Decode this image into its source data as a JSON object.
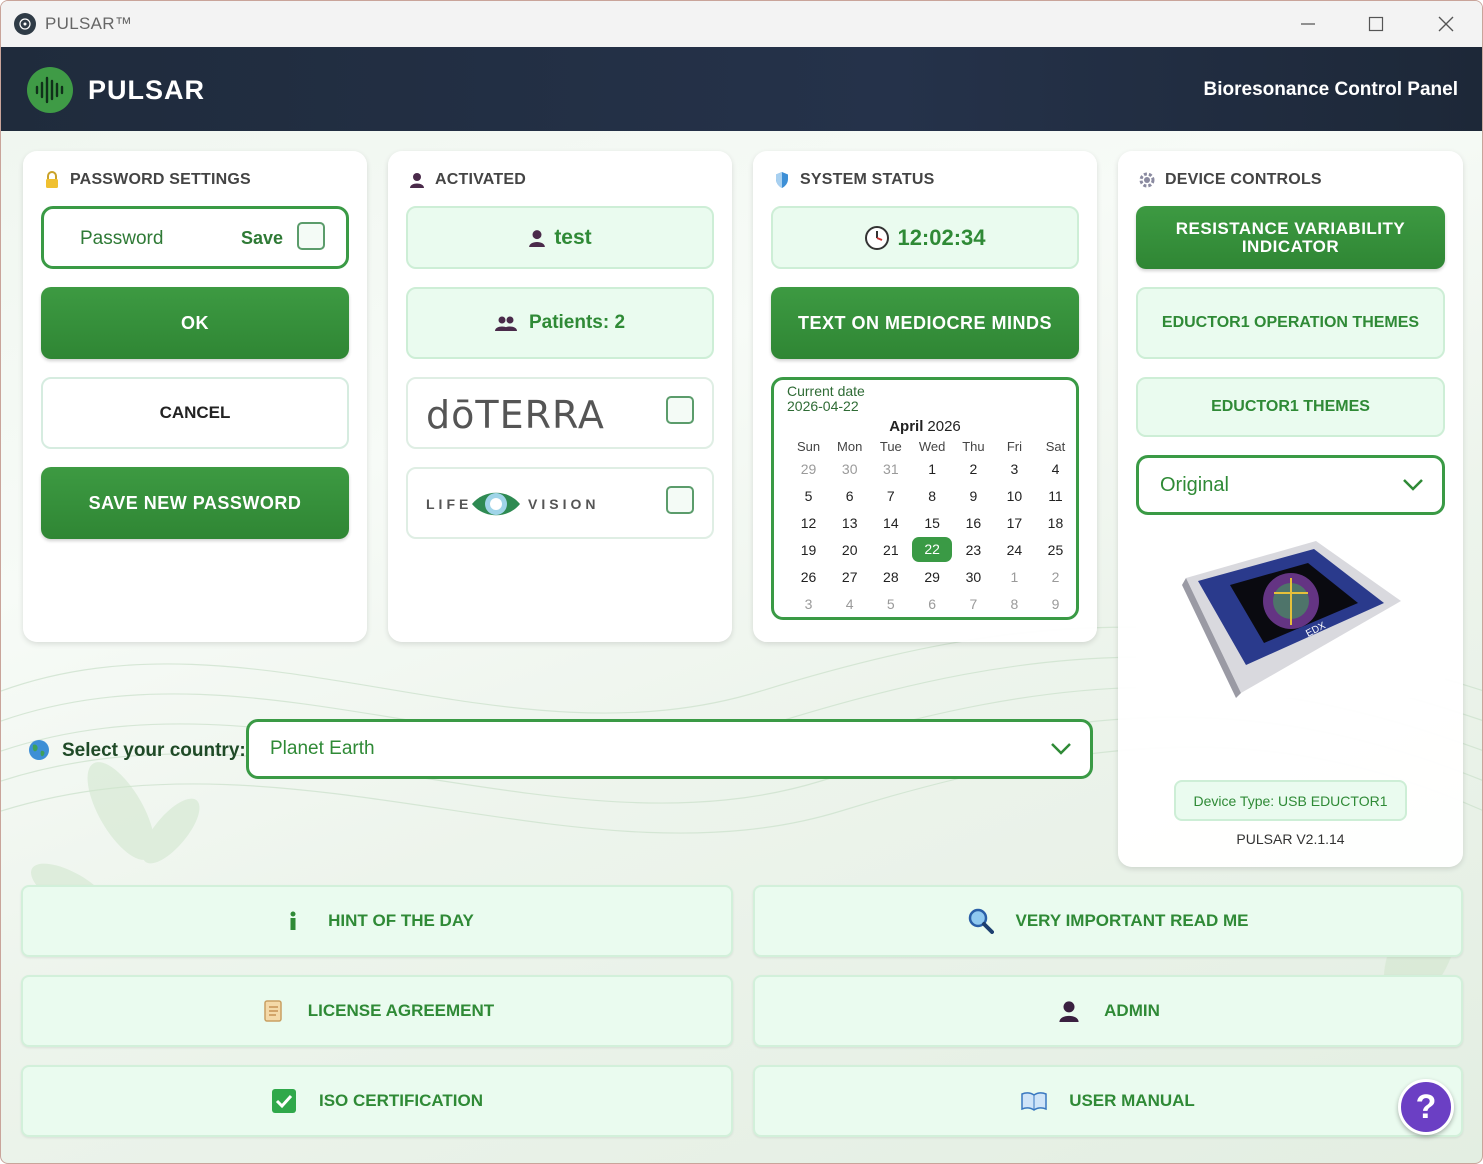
{
  "window": {
    "title": "PULSAR™"
  },
  "header": {
    "brand": "PULSAR",
    "subtitle": "Bioresonance Control Panel"
  },
  "password_panel": {
    "title": "PASSWORD SETTINGS",
    "password_placeholder": "Password",
    "save_label": "Save",
    "ok_label": "OK",
    "cancel_label": "CANCEL",
    "save_new_label": "SAVE NEW PASSWORD"
  },
  "activated_panel": {
    "title": "ACTIVATED",
    "user": "test",
    "patients": "Patients: 2",
    "brand1": "dōTERRA",
    "brand2_left": "LIFE",
    "brand2_right": "VISION"
  },
  "status_panel": {
    "title": "SYSTEM STATUS",
    "time": "12:02:34",
    "button": "TEXT ON MEDIOCRE MINDS",
    "calendar": {
      "label": "Current date",
      "date": "2026-04-22",
      "month": "April",
      "year": "2026",
      "weekdays": [
        "Sun",
        "Mon",
        "Tue",
        "Wed",
        "Thu",
        "Fri",
        "Sat"
      ],
      "weeks": [
        [
          "29",
          "30",
          "31",
          "1",
          "2",
          "3",
          "4"
        ],
        [
          "5",
          "6",
          "7",
          "8",
          "9",
          "10",
          "11"
        ],
        [
          "12",
          "13",
          "14",
          "15",
          "16",
          "17",
          "18"
        ],
        [
          "19",
          "20",
          "21",
          "22",
          "23",
          "24",
          "25"
        ],
        [
          "26",
          "27",
          "28",
          "29",
          "30",
          "1",
          "2"
        ],
        [
          "3",
          "4",
          "5",
          "6",
          "7",
          "8",
          "9"
        ]
      ],
      "selected": "22"
    }
  },
  "device_panel": {
    "title": "DEVICE CONTROLS",
    "btn_rvi": "RESISTANCE VARIABILITY INDICATOR",
    "btn_operation_themes": "EDUCTOR1 OPERATION THEMES",
    "btn_themes": "EDUCTOR1 THEMES",
    "theme_select": "Original",
    "device_label": "EDX",
    "device_type": "Device Type: USB EDUCTOR1",
    "version": "PULSAR V2.1.14"
  },
  "country": {
    "label": "Select your country:",
    "value": "Planet Earth"
  },
  "bottom_buttons": {
    "hint": "HINT OF THE DAY",
    "read_me": "VERY IMPORTANT READ ME",
    "license": "LICENSE AGREEMENT",
    "admin": "ADMIN",
    "iso": "ISO CERTIFICATION",
    "manual": "USER MANUAL"
  },
  "help": "?",
  "colors": {
    "accent": "#3a9a45",
    "header": "#1f2b3c",
    "help": "#6b3fc4"
  }
}
